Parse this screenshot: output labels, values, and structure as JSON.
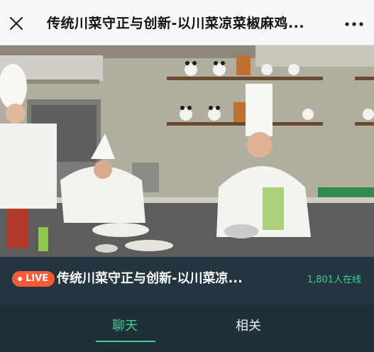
{
  "header": {
    "title": "传统川菜守正与创新-以川菜凉菜椒麻鸡...",
    "close_icon": "close-icon",
    "more_icon": "more-icon"
  },
  "video": {
    "description_icon": "video-player"
  },
  "stream": {
    "live_label": "LIVE",
    "title": "传统川菜守正与创新-以川菜凉...",
    "viewers": "1,801人在线",
    "accent_color": "#3ecf8e",
    "live_color": "#ff5a38"
  },
  "tabs": [
    {
      "label": "聊天",
      "active": true
    },
    {
      "label": "相关",
      "active": false
    }
  ]
}
